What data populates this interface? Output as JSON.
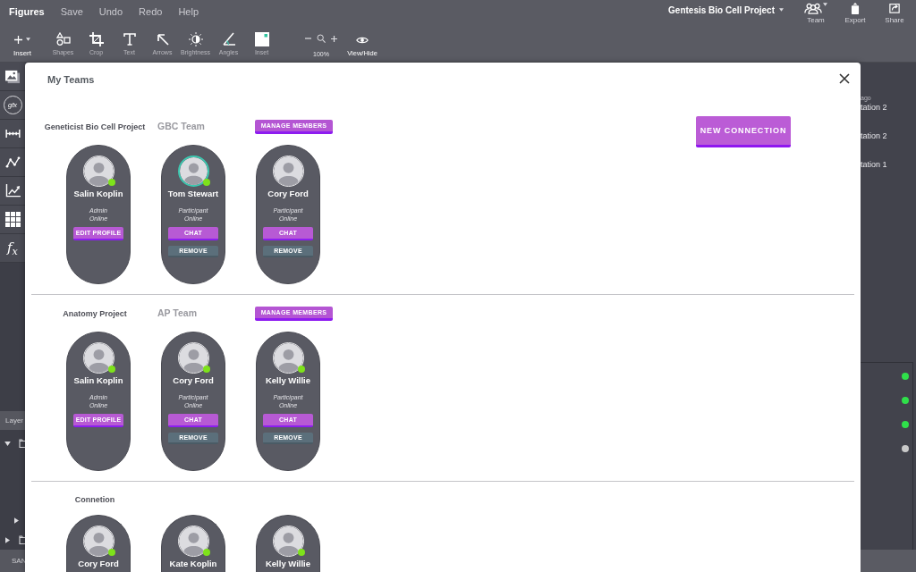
{
  "menu_bar": {
    "app_title": "Figures",
    "items": [
      "Save",
      "Undo",
      "Redo",
      "Help"
    ],
    "project": "Gentesis Bio Cell Project",
    "actions": [
      {
        "kind": "team",
        "label": "Team"
      },
      {
        "kind": "export",
        "label": "Export"
      },
      {
        "kind": "share",
        "label": "Share"
      }
    ]
  },
  "toolbar": {
    "tools": [
      {
        "kind": "insert",
        "label": "Insert"
      },
      {
        "kind": "shapes",
        "label": "Shapes"
      },
      {
        "kind": "crop",
        "label": "Crop"
      },
      {
        "kind": "text",
        "label": "Text"
      },
      {
        "kind": "arrows",
        "label": "Arrows"
      },
      {
        "kind": "brightness",
        "label": "Brightness"
      },
      {
        "kind": "angles",
        "label": "Angles"
      },
      {
        "kind": "inset",
        "label": "Inset"
      }
    ],
    "zoom_level": "100%",
    "view_toggle": "View/Hide"
  },
  "left_rail": {
    "graphics_symbol": "gfx",
    "function_symbol": "f$_{x}$",
    "layers_heading": "Layer",
    "layer_tree": [
      {
        "expanded": true,
        "children": [
          {
            "expanded": false
          }
        ]
      },
      {
        "expanded": false
      }
    ],
    "footer": "SAN"
  },
  "dialog": {
    "title": "My Teams",
    "new_connection_button": "NEW CONNECTION",
    "teams": [
      {
        "project": "Geneticist Bio Cell Project",
        "team": "GBC Team",
        "manage_button": "MANAGE MEMBERS",
        "members": [
          {
            "name": "Salin Koplin",
            "role": "Admin",
            "status": "Online",
            "online": true,
            "highlighted": false,
            "buttons": [
              {
                "kind": "primary",
                "label": "EDIT PROFILE"
              }
            ]
          },
          {
            "name": "Tom Stewart",
            "role": "Participant",
            "status": "Online",
            "online": true,
            "highlighted": true,
            "buttons": [
              {
                "kind": "primary",
                "label": "CHAT"
              },
              {
                "kind": "secondary",
                "label": "REMOVE"
              }
            ]
          },
          {
            "name": "Cory Ford",
            "role": "Participant",
            "status": "Online",
            "online": false,
            "highlighted": false,
            "buttons": [
              {
                "kind": "primary",
                "label": "CHAT"
              },
              {
                "kind": "secondary",
                "label": "REMOVE"
              }
            ]
          }
        ]
      },
      {
        "project": "Anatomy Project",
        "team": "AP Team",
        "manage_button": "MANAGE MEMBERS",
        "members": [
          {
            "name": "Salin Koplin",
            "role": "Admin",
            "status": "Online",
            "online": true,
            "highlighted": false,
            "buttons": [
              {
                "kind": "primary",
                "label": "EDIT PROFILE"
              }
            ]
          },
          {
            "name": "Cory Ford",
            "role": "Participant",
            "status": "Online",
            "online": true,
            "highlighted": false,
            "buttons": [
              {
                "kind": "primary",
                "label": "CHAT"
              },
              {
                "kind": "secondary",
                "label": "REMOVE"
              }
            ]
          },
          {
            "name": "Kelly Willie",
            "role": "Participant",
            "status": "Online",
            "online": true,
            "highlighted": false,
            "buttons": [
              {
                "kind": "primary",
                "label": "CHAT"
              },
              {
                "kind": "secondary",
                "label": "REMOVE"
              }
            ]
          }
        ]
      }
    ],
    "connections": {
      "heading": "Connetion",
      "members": [
        {
          "name": "Cory Ford",
          "online": true,
          "highlighted": false
        },
        {
          "name": "Kate Koplin",
          "online": true,
          "highlighted": false
        },
        {
          "name": "Kelly Willie",
          "online": true,
          "highlighted": false
        }
      ]
    }
  },
  "right_panel": {
    "time_note": "ago",
    "items": [
      "tation 2",
      "tation 2",
      "tation 1"
    ],
    "status_dots": [
      {
        "color": "#2fe04a"
      },
      {
        "color": "#2fe04a"
      },
      {
        "color": "#2fe04a"
      },
      {
        "color": "#c9c9c9"
      }
    ]
  }
}
